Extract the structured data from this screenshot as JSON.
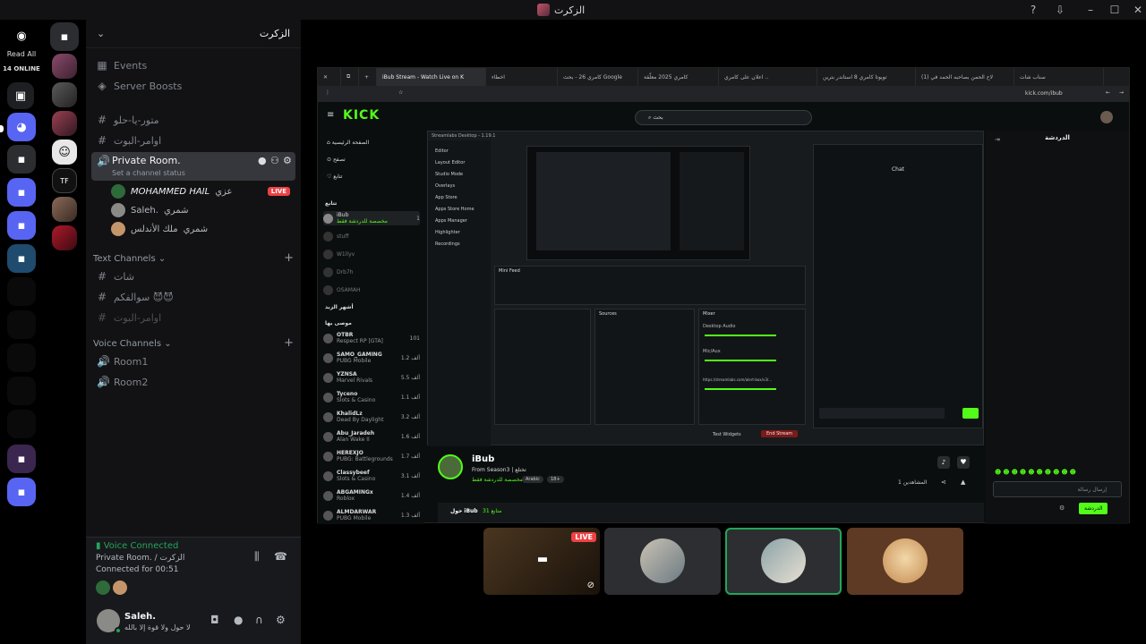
{
  "window": {
    "title": "الزكرت"
  },
  "rail": {
    "read_all": "Read All",
    "online": "14 ONLINE"
  },
  "channels": {
    "guild_name": "الزكرت",
    "events": "Events",
    "boosts": "Server Boosts",
    "top_channels": [
      "متور-يا-حلو",
      "اوامر-البوت"
    ],
    "private_room": "Private Room.",
    "status_placeholder": "Set a channel status",
    "voice_users": [
      {
        "name": "MOHAMMED HAIL",
        "tag": "عزي",
        "live": "LIVE"
      },
      {
        "name": "Saleh.",
        "tag": "شمري"
      },
      {
        "name": "ملك الأندلس",
        "tag": "شمري"
      }
    ],
    "text_cat": "Text Channels",
    "text_channels": [
      "شات",
      "سوالفكم 😈😈",
      "اوامر-البوت"
    ],
    "voice_cat": "Voice Channels",
    "voice_channels": [
      "Room1",
      "Room2"
    ]
  },
  "voice_panel": {
    "status": "Voice Connected",
    "location": "Private Room. / الزكرت",
    "time": "Connected for 00:51"
  },
  "user": {
    "name": "Saleh.",
    "status": "لا حول ولا قوة إلا بالله"
  },
  "stream": {
    "tabs": [
      "iBub Stream - Watch Live on K",
      "اخطاء",
      "كامري 26 - بحث Google",
      "كامري 2025 معلّقة",
      "اعلان على كامري ..",
      "تويوتا كامري 8 استاندر بترين",
      "(1) لاح الحمن بصاحبه الحمد في",
      "سناب شات"
    ],
    "url": "kick.com/ibub",
    "search": "بحث",
    "kick_logo": "KICK",
    "nav": [
      "الصفحة الرئيسية",
      "تصفح",
      "تتابع"
    ],
    "following": "تتابع",
    "recommended": "أشهر الزبد",
    "featured_hdr": "موصى بها",
    "followed": [
      {
        "name": "iBub",
        "sub": "مخصصة للدردشة فقط",
        "v": "1"
      },
      {
        "name": "stuff",
        "sub": "",
        "v": ""
      },
      {
        "name": "W1llyv",
        "sub": "",
        "v": ""
      },
      {
        "name": "Drb7h",
        "sub": "",
        "v": ""
      },
      {
        "name": "OSAMAH",
        "sub": "",
        "v": ""
      }
    ],
    "featured": [
      {
        "name": "OTBR",
        "sub": "Respect RP [GTA]",
        "v": "101"
      },
      {
        "name": "SAMO_GAMING",
        "sub": "PUBG Mobile",
        "v": "1.2 ألف"
      },
      {
        "name": "YZNSA",
        "sub": "Marvel Rivals",
        "v": "5.5 ألف"
      },
      {
        "name": "Tyceno",
        "sub": "Slots & Casino",
        "v": "1.1 ألف"
      },
      {
        "name": "KhalidLz",
        "sub": "Dead By Daylight",
        "v": "3.2 ألف"
      },
      {
        "name": "Abu_Jaradeh",
        "sub": "Alan Wake II",
        "v": "1.6 ألف"
      },
      {
        "name": "HEREXJO",
        "sub": "PUBG: Battlegrounds",
        "v": "1.7 ألف"
      },
      {
        "name": "Classybeef",
        "sub": "Slots & Casino",
        "v": "3.1 ألف"
      },
      {
        "name": "ABGAMINGx",
        "sub": "Roblox",
        "v": "1.4 ألف"
      },
      {
        "name": "ALMDARWAR",
        "sub": "PUBG Mobile",
        "v": "1.3 ألف"
      }
    ],
    "streamer": "iBub",
    "stream_title": "From Season3 | تختلع",
    "stream_tags": [
      "Arabic",
      "18+"
    ],
    "stream_cat": "مخصصة للدردشة فقط",
    "viewers": "المشاهدين 1",
    "about": "حول iBub",
    "followers": "31 متابع",
    "chat_hdr": "الدردشة",
    "chat_placeholder": "إرسال رسالة",
    "chat_btn": "الدردشة",
    "obs_title": "Streamlabs Desktop - 1.19.1",
    "obs_menu": [
      "Editor",
      "Layout Editor",
      "Studio Mode",
      "Overlays",
      "App Store",
      "Apps Store Home",
      "Apps Manager",
      "Highlighter",
      "Recordings"
    ],
    "mini_feed": "Mini Feed",
    "sources": "Sources",
    "mixer": "Mixer",
    "mixer_items": [
      "Desktop Audio",
      "Mic/Aux",
      "https://streamlabs.com/alert-box/v3/..."
    ],
    "obs_chat": "Chat",
    "end_stream": "End Stream",
    "test_widgets": "Test Widgets"
  },
  "tiles": [
    {
      "live": "LIVE"
    }
  ]
}
